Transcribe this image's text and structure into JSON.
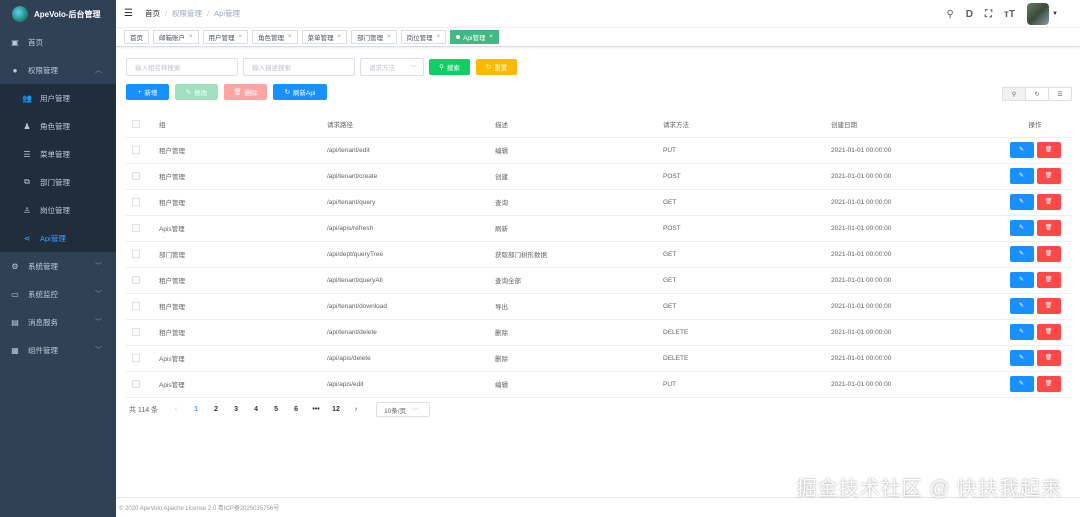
{
  "app": {
    "title": "ApeVolo-后台管理"
  },
  "sidebar": {
    "home": "首页",
    "perm": "权限管理",
    "perm_children": [
      "用户管理",
      "角色管理",
      "菜单管理",
      "部门管理",
      "岗位管理",
      "Api管理"
    ],
    "system": "系统管理",
    "monitor": "系统监控",
    "message": "消息服务",
    "components": "组件管理"
  },
  "breadcrumb": [
    "首页",
    "权限管理",
    "Api管理"
  ],
  "tags": [
    "首页",
    "邮箱账户",
    "用户管理",
    "角色管理",
    "菜单管理",
    "部门管理",
    "岗位管理",
    "Api管理"
  ],
  "search": {
    "group_placeholder": "输入组名称搜索",
    "desc_placeholder": "输入描述搜索",
    "method_placeholder": "请求方法",
    "search_label": "搜索",
    "reset_label": "重置"
  },
  "actions": {
    "add": "新增",
    "edit": "修改",
    "delete": "删除",
    "refresh": "刷新Api"
  },
  "colors": {
    "sidebar_bg": "#304156",
    "primary": "#1890ff",
    "success": "#13ce66",
    "warning": "#ffba00",
    "danger": "#ff4949",
    "tag_active": "#42b983"
  },
  "table": {
    "headers": [
      "组",
      "请求路径",
      "描述",
      "请求方法",
      "创建日期",
      "操作"
    ],
    "rows": [
      [
        "租户管理",
        "/api/tenant/edit",
        "编辑",
        "PUT",
        "2021-01-01 00:00:00"
      ],
      [
        "租户管理",
        "/api/tenant/create",
        "创建",
        "POST",
        "2021-01-01 00:00:00"
      ],
      [
        "租户管理",
        "/api/tenant/query",
        "查询",
        "GET",
        "2021-01-01 00:00:00"
      ],
      [
        "Apis管理",
        "/api/apis/refresh",
        "刷新",
        "POST",
        "2021-01-01 00:00:00"
      ],
      [
        "部门管理",
        "/api/dept/queryTree",
        "获取部门树形数据",
        "GET",
        "2021-01-01 00:00:00"
      ],
      [
        "租户管理",
        "/api/tenant/queryAll",
        "查询全部",
        "GET",
        "2021-01-01 00:00:00"
      ],
      [
        "租户管理",
        "/api/tenant/download",
        "导出",
        "GET",
        "2021-01-01 00:00:00"
      ],
      [
        "租户管理",
        "/api/tenant/delete",
        "删除",
        "DELETE",
        "2021-01-01 00:00:00"
      ],
      [
        "Apis管理",
        "/api/apis/delete",
        "删除",
        "DELETE",
        "2021-01-01 00:00:00"
      ],
      [
        "Apis管理",
        "/api/apis/edit",
        "编辑",
        "PUT",
        "2021-01-01 00:00:00"
      ]
    ]
  },
  "pager": {
    "total": "共 114 条",
    "pages": [
      "1",
      "2",
      "3",
      "4",
      "5",
      "6",
      "•••",
      "12"
    ],
    "page_size": "10条/页"
  },
  "footer": "© 2020 ApeVolo Apache License 2.0   粤ICP备2025035756号",
  "watermark": "掘金技术社区 @ 快扶我起来"
}
